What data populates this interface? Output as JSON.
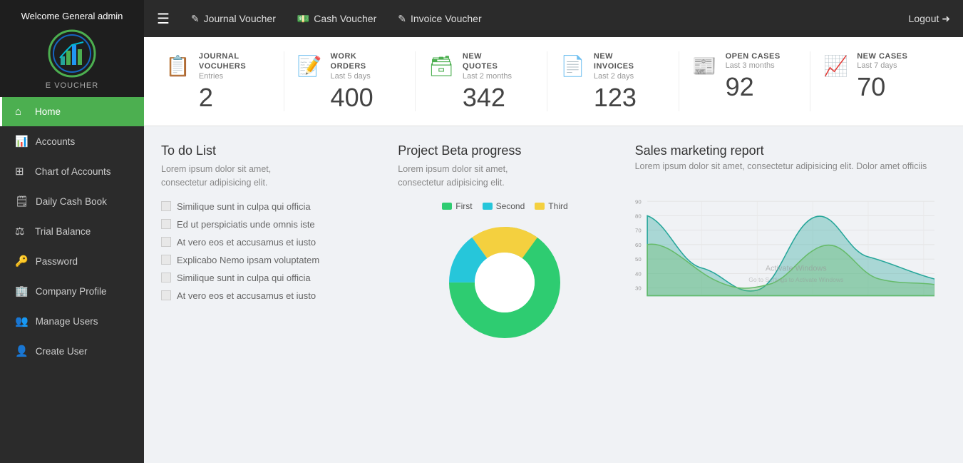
{
  "sidebar": {
    "welcome": "Welcome General\nadmin",
    "brand": "E VOUCHER",
    "items": [
      {
        "id": "home",
        "label": "Home",
        "icon": "⌂",
        "active": true
      },
      {
        "id": "accounts",
        "label": "Accounts",
        "icon": "📊",
        "active": false
      },
      {
        "id": "chart-of-accounts",
        "label": "Chart of Accounts",
        "icon": "⊞",
        "active": false
      },
      {
        "id": "daily-cash-book",
        "label": "Daily Cash Book",
        "icon": "🗒",
        "active": false
      },
      {
        "id": "trial-balance",
        "label": "Trial Balance",
        "icon": "⚖",
        "active": false
      },
      {
        "id": "password",
        "label": "Password",
        "icon": "🔑",
        "active": false
      },
      {
        "id": "company-profile",
        "label": "Company Profile",
        "icon": "🏢",
        "active": false
      },
      {
        "id": "manage-users",
        "label": "Manage Users",
        "icon": "👥",
        "active": false
      },
      {
        "id": "create-user",
        "label": "Create User",
        "icon": "👤",
        "active": false
      }
    ]
  },
  "topbar": {
    "journal_voucher": "Journal Voucher",
    "cash_voucher": "Cash Voucher",
    "invoice_voucher": "Invoice Voucher",
    "logout": "Logout"
  },
  "stats": [
    {
      "id": "journal-vouchers",
      "label": "JOURNAL\nVOCUHERS",
      "sublabel": "Entries",
      "value": "2",
      "icon": "📋",
      "color": "blue"
    },
    {
      "id": "work-orders",
      "label": "WORK\nORDERS",
      "sublabel": "Last 5 days",
      "value": "400",
      "icon": "📝",
      "color": "teal"
    },
    {
      "id": "new-quotes",
      "label": "NEW\nQUOTES",
      "sublabel": "Last 2 months",
      "value": "342",
      "icon": "🗃",
      "color": "green"
    },
    {
      "id": "new-invoices",
      "label": "NEW\nINVOICES",
      "sublabel": "Last 2 days",
      "value": "123",
      "icon": "📄",
      "color": "blue"
    },
    {
      "id": "open-cases",
      "label": "OPEN CASES",
      "sublabel": "Last 3 months",
      "value": "92",
      "icon": "📰",
      "color": "purple"
    },
    {
      "id": "new-cases",
      "label": "NEW CASES",
      "sublabel": "Last 7 days",
      "value": "70",
      "icon": "📈",
      "color": "orange"
    }
  ],
  "todo": {
    "title": "To do List",
    "desc": "Lorem ipsum dolor sit amet,\nconsectetur adipisicing elit.",
    "items": [
      "Similique sunt in culpa qui officia",
      "Ed ut perspiciatis unde omnis iste",
      "At vero eos et accusamus et iusto",
      "Explicabo Nemo ipsam voluptatem",
      "Similique sunt in culpa qui officia",
      "At vero eos et accusamus et iusto"
    ]
  },
  "project_beta": {
    "title": "Project Beta progress",
    "desc": "Lorem ipsum dolor sit amet,\nconsectetur adipisicing elit.",
    "legend": [
      {
        "label": "First",
        "color": "#2ecc71"
      },
      {
        "label": "Second",
        "color": "#26c6da"
      },
      {
        "label": "Third",
        "color": "#f4d03f"
      }
    ]
  },
  "sales_report": {
    "title": "Sales marketing report",
    "desc": "Lorem ipsum dolor sit amet, consectetur adipisicing elit. Dolor amet officiis",
    "y_labels": [
      "90",
      "80",
      "70",
      "60",
      "50",
      "40",
      "30"
    ],
    "watermark_line1": "Activate Windows",
    "watermark_line2": "Go to Settings to Activate Windows"
  }
}
